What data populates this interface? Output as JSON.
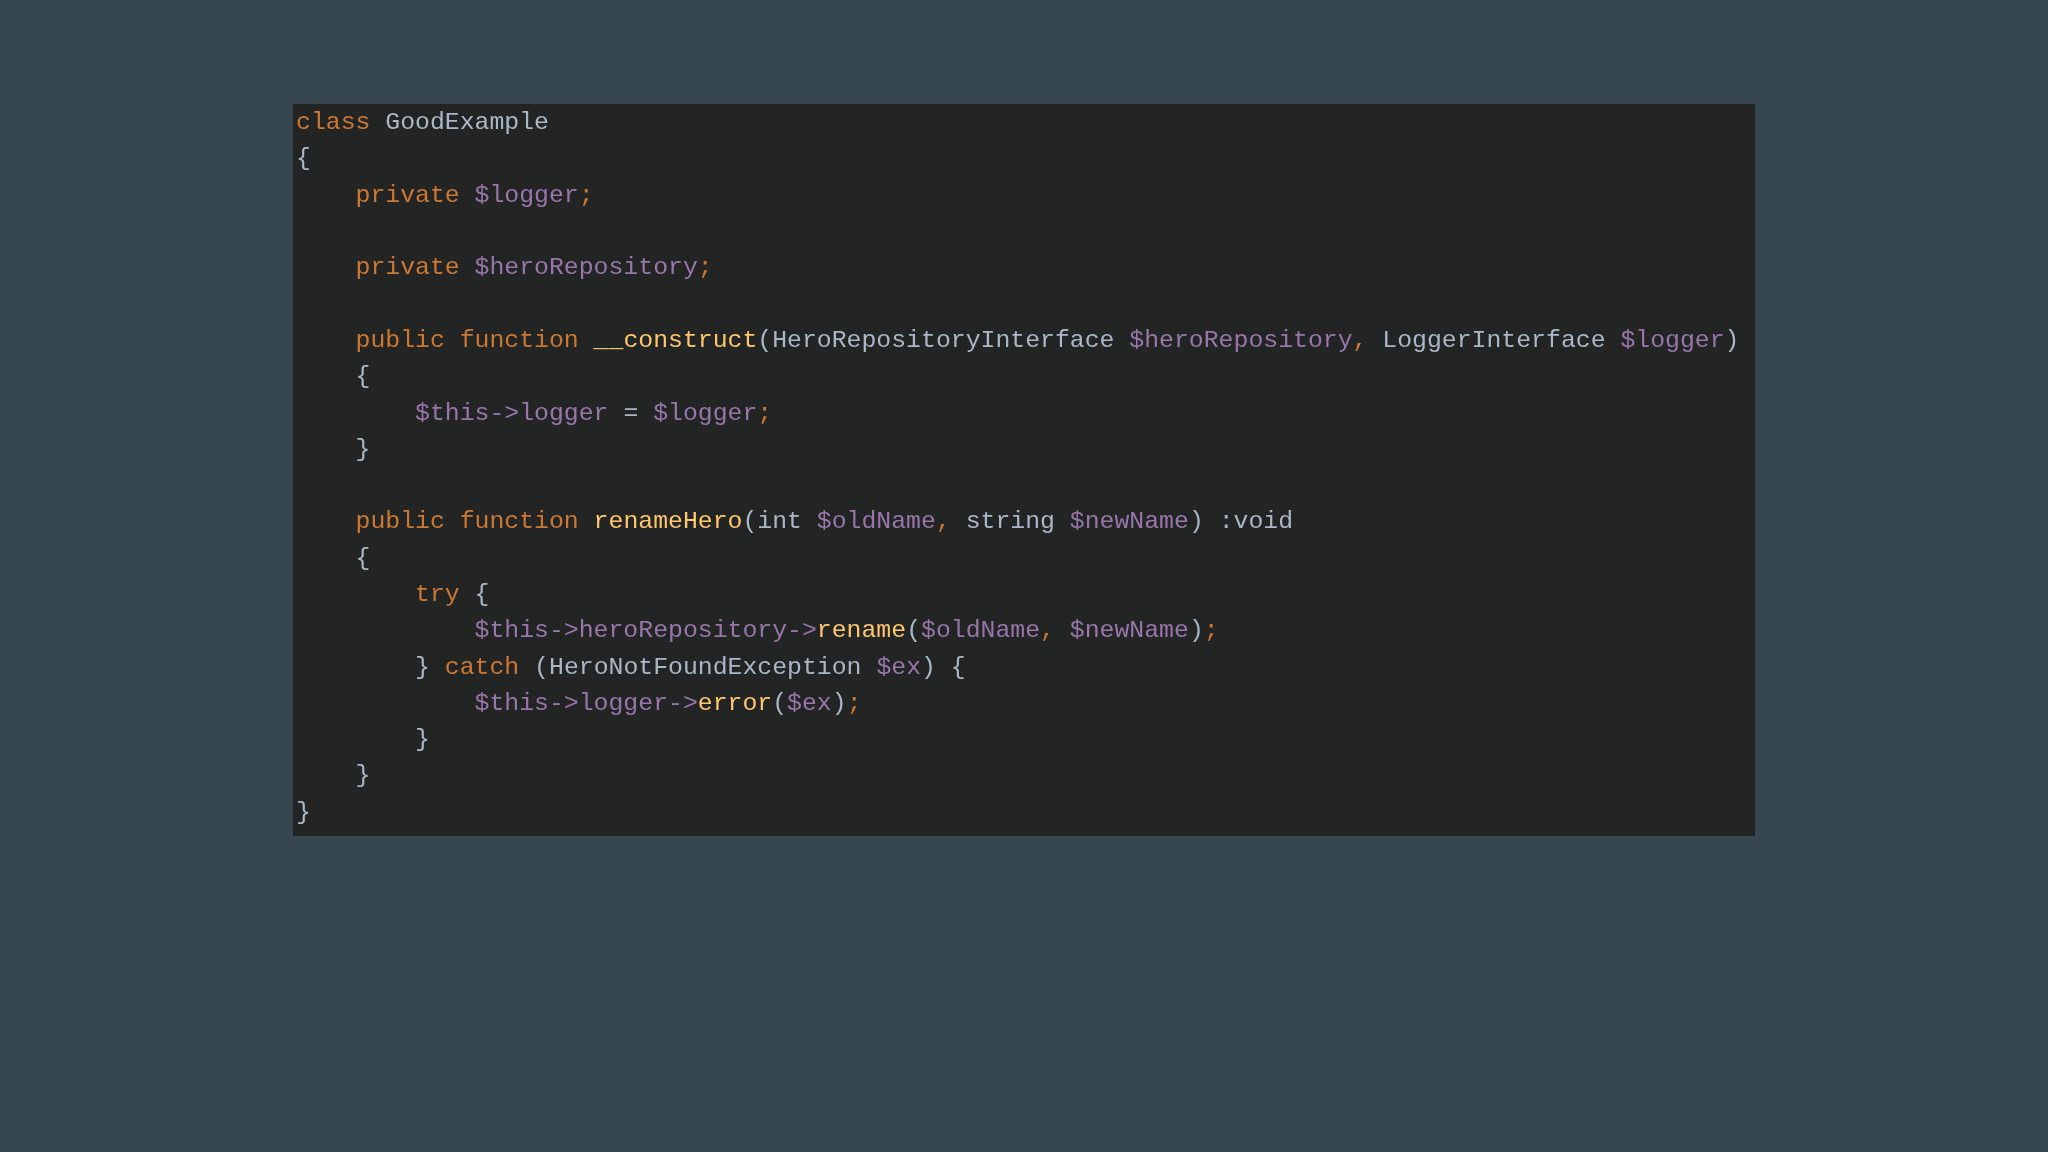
{
  "code_lines": [
    {
      "kind": "code",
      "tokens": [
        {
          "kind": "kw",
          "text": "class"
        },
        {
          "kind": "plain",
          "text": " GoodExample"
        }
      ]
    },
    {
      "kind": "code",
      "tokens": [
        {
          "kind": "plain",
          "text": "{"
        }
      ]
    },
    {
      "kind": "code",
      "tokens": [
        {
          "kind": "kw",
          "text": "    private"
        },
        {
          "kind": "var",
          "text": " $logger"
        },
        {
          "kind": "kw",
          "text": ";"
        }
      ]
    },
    {
      "kind": "blank"
    },
    {
      "kind": "code",
      "tokens": [
        {
          "kind": "kw",
          "text": "    private"
        },
        {
          "kind": "var",
          "text": " $heroRepository"
        },
        {
          "kind": "kw",
          "text": ";"
        }
      ]
    },
    {
      "kind": "blank"
    },
    {
      "kind": "code",
      "tokens": [
        {
          "kind": "kw",
          "text": "    public function"
        },
        {
          "kind": "fn",
          "text": " __construct"
        },
        {
          "kind": "plain",
          "text": "(HeroRepositoryInterface"
        },
        {
          "kind": "var",
          "text": " $heroRepository"
        },
        {
          "kind": "kw",
          "text": ","
        },
        {
          "kind": "plain",
          "text": " LoggerInterface"
        },
        {
          "kind": "var",
          "text": " $logger"
        },
        {
          "kind": "plain",
          "text": ")"
        }
      ]
    },
    {
      "kind": "code",
      "tokens": [
        {
          "kind": "plain",
          "text": "    {"
        }
      ]
    },
    {
      "kind": "code",
      "tokens": [
        {
          "kind": "var",
          "text": "        $this->logger"
        },
        {
          "kind": "plain",
          "text": " ="
        },
        {
          "kind": "var",
          "text": " $logger"
        },
        {
          "kind": "kw",
          "text": ";"
        }
      ]
    },
    {
      "kind": "code",
      "tokens": [
        {
          "kind": "plain",
          "text": "    }"
        }
      ]
    },
    {
      "kind": "blank"
    },
    {
      "kind": "code",
      "tokens": [
        {
          "kind": "kw",
          "text": "    public function"
        },
        {
          "kind": "fn",
          "text": " renameHero"
        },
        {
          "kind": "plain",
          "text": "(int"
        },
        {
          "kind": "var",
          "text": " $oldName"
        },
        {
          "kind": "kw",
          "text": ","
        },
        {
          "kind": "plain",
          "text": " string"
        },
        {
          "kind": "var",
          "text": " $newName"
        },
        {
          "kind": "plain",
          "text": ") :void"
        }
      ]
    },
    {
      "kind": "code",
      "tokens": [
        {
          "kind": "plain",
          "text": "    {"
        }
      ]
    },
    {
      "kind": "code",
      "tokens": [
        {
          "kind": "kw",
          "text": "        try"
        },
        {
          "kind": "plain",
          "text": " {"
        }
      ]
    },
    {
      "kind": "code",
      "tokens": [
        {
          "kind": "var",
          "text": "            $this->heroRepository->"
        },
        {
          "kind": "fn",
          "text": "rename"
        },
        {
          "kind": "plain",
          "text": "("
        },
        {
          "kind": "var",
          "text": "$oldName"
        },
        {
          "kind": "kw",
          "text": ","
        },
        {
          "kind": "var",
          "text": " $newName"
        },
        {
          "kind": "plain",
          "text": ")"
        },
        {
          "kind": "kw",
          "text": ";"
        }
      ]
    },
    {
      "kind": "code",
      "tokens": [
        {
          "kind": "plain",
          "text": "        }"
        },
        {
          "kind": "kw",
          "text": " catch"
        },
        {
          "kind": "plain",
          "text": " (HeroNotFoundException"
        },
        {
          "kind": "var",
          "text": " $ex"
        },
        {
          "kind": "plain",
          "text": ") {"
        }
      ]
    },
    {
      "kind": "code",
      "tokens": [
        {
          "kind": "var",
          "text": "            $this->logger->"
        },
        {
          "kind": "fn",
          "text": "error"
        },
        {
          "kind": "plain",
          "text": "("
        },
        {
          "kind": "var",
          "text": "$ex"
        },
        {
          "kind": "plain",
          "text": ")"
        },
        {
          "kind": "kw",
          "text": ";"
        }
      ]
    },
    {
      "kind": "code",
      "tokens": [
        {
          "kind": "plain",
          "text": "        }"
        }
      ]
    },
    {
      "kind": "code",
      "tokens": [
        {
          "kind": "plain",
          "text": "    }"
        }
      ]
    },
    {
      "kind": "code",
      "tokens": [
        {
          "kind": "plain",
          "text": "}"
        }
      ]
    }
  ]
}
